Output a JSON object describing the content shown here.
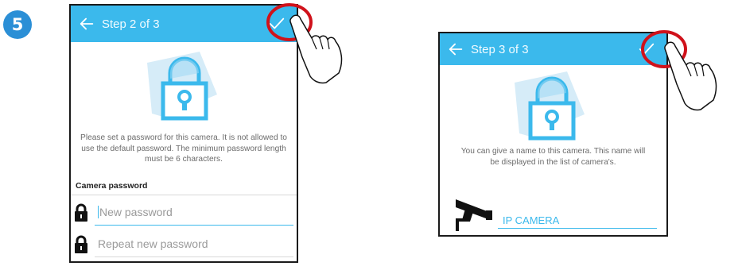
{
  "step_number": "5",
  "screen1": {
    "title": "Step 2 of 3",
    "icons": {
      "back": "arrow-left-icon",
      "confirm": "checkmark-icon",
      "illustration": "padlock-icon"
    },
    "description": "Please set a password for this camera. It is not allowed to use the default password. The minimum password length must be 6 characters.",
    "section_label": "Camera password",
    "password_placeholder": "New password",
    "repeat_placeholder": "Repeat new password"
  },
  "screen2": {
    "title": "Step 3 of 3",
    "icons": {
      "back": "arrow-left-icon",
      "confirm": "checkmark-icon",
      "illustration": "padlock-icon",
      "camera": "security-camera-icon"
    },
    "description": "You can give a name to this camera. This name will be displayed in the list of camera's.",
    "camera_name": "IP CAMERA"
  },
  "colors": {
    "app_bar": "#3bb9ec",
    "highlight_circle": "#d0121b",
    "step_badge": "#2b8fd6"
  }
}
